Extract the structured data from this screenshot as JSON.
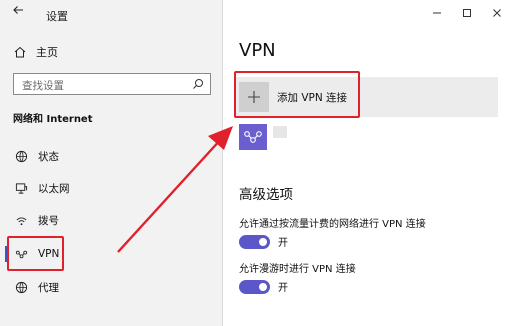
{
  "window": {
    "title": "设置",
    "back_icon": "back-arrow-icon",
    "controls": [
      "minimize-icon",
      "maximize-icon",
      "close-icon"
    ]
  },
  "sidebar": {
    "home_label": "主页",
    "search_placeholder": "查找设置",
    "section_header": "网络和 Internet",
    "items": [
      {
        "label": "状态",
        "icon": "status-globe-icon"
      },
      {
        "label": "以太网",
        "icon": "ethernet-icon"
      },
      {
        "label": "拨号",
        "icon": "dialup-icon"
      },
      {
        "label": "VPN",
        "icon": "vpn-icon",
        "selected": true
      },
      {
        "label": "代理",
        "icon": "proxy-globe-icon"
      }
    ]
  },
  "main": {
    "title": "VPN",
    "add_vpn_label": "添加 VPN 连接",
    "advanced_heading": "高级选项",
    "options": [
      {
        "label": "允许通过按流量计费的网络进行 VPN 连接",
        "toggle_label": "开",
        "on": true
      },
      {
        "label": "允许漫游时进行 VPN 连接",
        "toggle_label": "开",
        "on": true
      }
    ]
  },
  "colors": {
    "accent": "#5b57c8",
    "highlight": "#e0202a",
    "sidebar_bg": "#f2f2f2",
    "vpn_tile": "#6b5fd0"
  }
}
